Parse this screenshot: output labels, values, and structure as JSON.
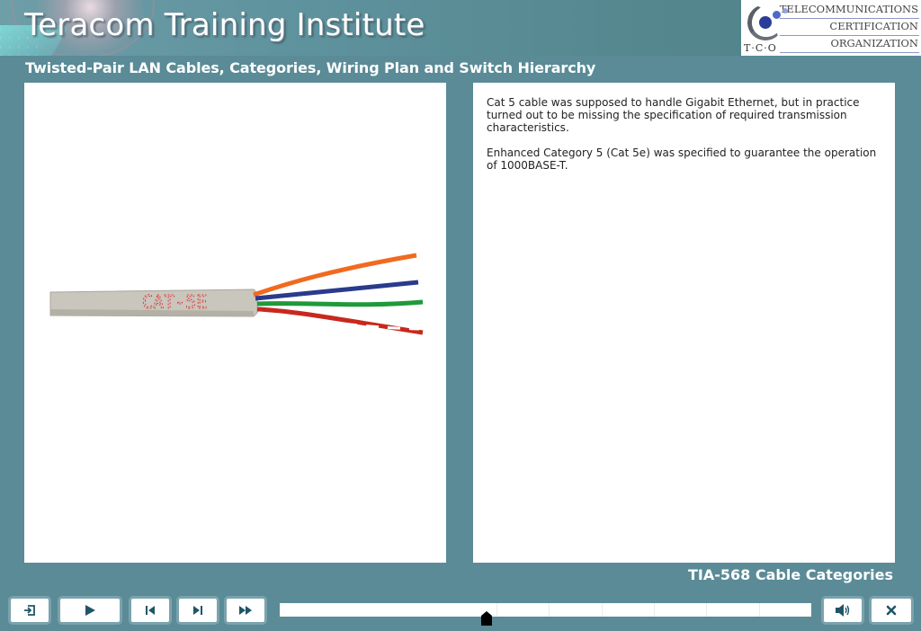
{
  "header": {
    "brand_title": "Teracom Training Institute",
    "logo": {
      "mark_letters": "T·C·O",
      "lines": [
        "TELECOMMUNICATIONS",
        "CERTIFICATION",
        "ORGANIZATION"
      ]
    }
  },
  "course": {
    "title": "Twisted-Pair LAN Cables, Categories, Wiring Plan and Switch Hierarchy"
  },
  "slide": {
    "image": {
      "alt": "Category 5e UTP cable with four twisted pairs exposed",
      "jacket_print": "CAT-5E",
      "pair_colors": [
        "#f06a20",
        "#2a3a8c",
        "#1f9a3a",
        "#c8281e"
      ],
      "jacket_color": "#c9c6bd",
      "print_color": "#e04040"
    },
    "paragraphs": [
      "Cat 5 cable was supposed to handle Gigabit Ethernet, but in practice turned out to be missing the specification of required transmission characteristics.",
      "Enhanced Category 5 (Cat 5e) was specified to guarantee the operation of 1000BASE-T."
    ],
    "topic": "TIA-568 Cable Categories"
  },
  "controls": {
    "exit": {
      "icon": "exit-icon",
      "label": "Exit"
    },
    "play": {
      "icon": "play-icon",
      "label": "Play"
    },
    "previous": {
      "icon": "skip-back-icon",
      "label": "Previous"
    },
    "next": {
      "icon": "skip-forward-icon",
      "label": "Next"
    },
    "fast_forward": {
      "icon": "fast-forward-icon",
      "label": "Fast forward"
    },
    "volume": {
      "icon": "speaker-icon",
      "label": "Volume"
    },
    "close": {
      "icon": "close-icon",
      "label": "Close"
    }
  },
  "progress": {
    "position_fraction": 0.39,
    "segments": 7
  },
  "colors": {
    "background": "#5a8b97",
    "icon": "#1f5566",
    "button_border": "#7aa3ad"
  }
}
